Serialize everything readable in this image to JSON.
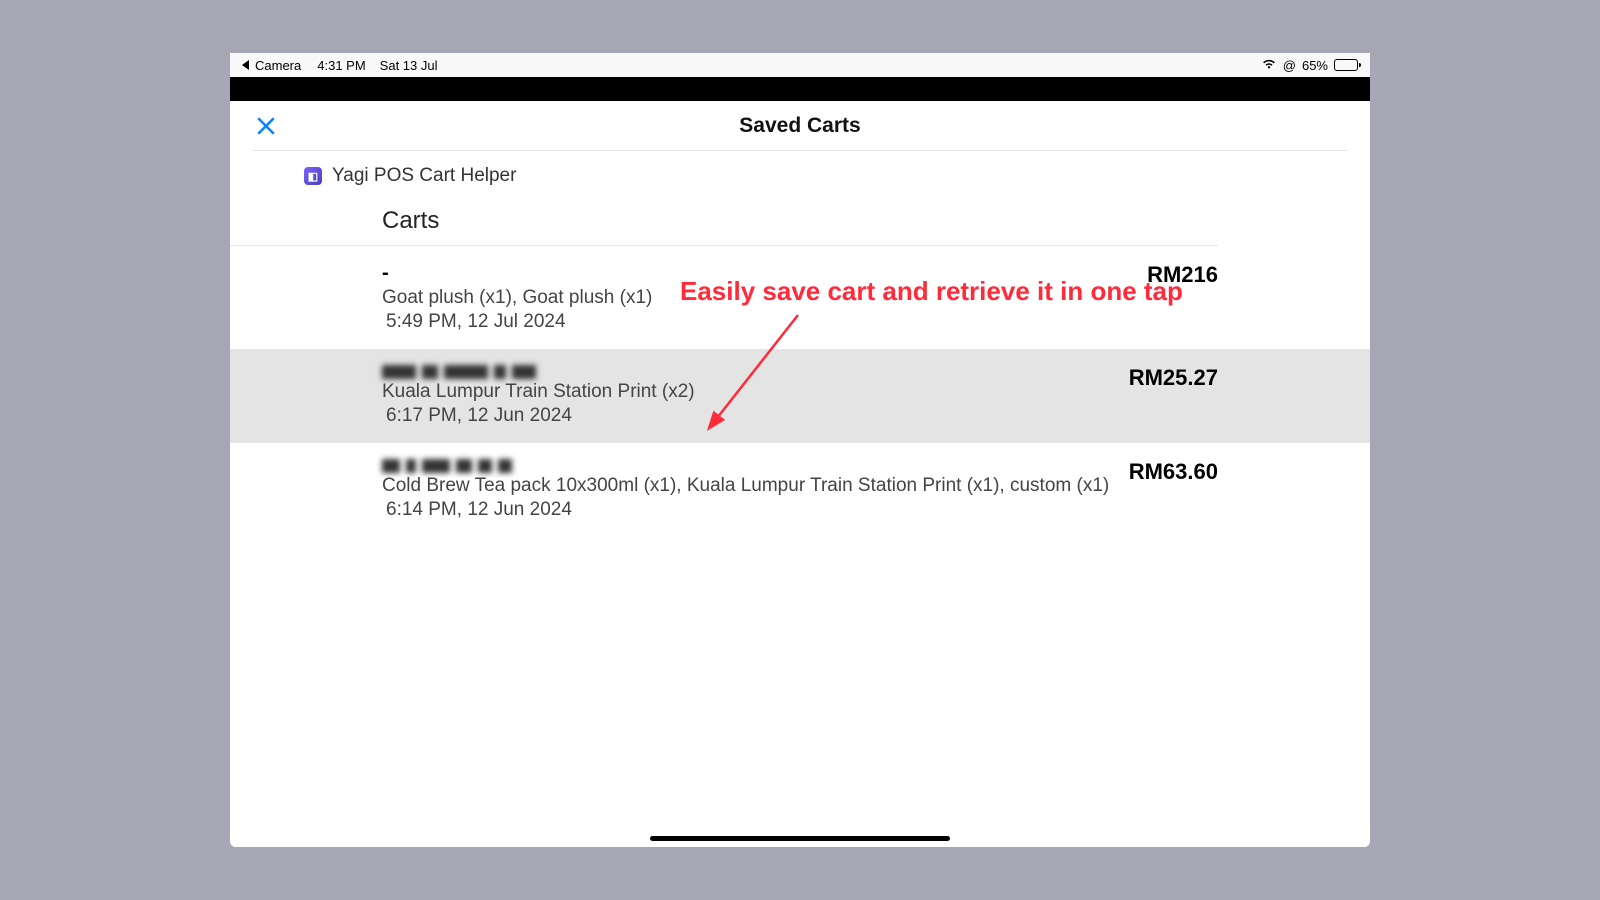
{
  "statusbar": {
    "back_app": "Camera",
    "time": "4:31 PM",
    "date": "Sat 13 Jul",
    "battery_pct": "65%"
  },
  "sheet": {
    "title": "Saved Carts",
    "app_name": "Yagi POS Cart Helper",
    "section_label": "Carts"
  },
  "carts": [
    {
      "name": "-",
      "items": "Goat plush (x1), Goat plush (x1)",
      "timestamp": "5:49 PM, 12 Jul 2024",
      "price": "RM216",
      "selected": false,
      "redacted": false
    },
    {
      "name": "",
      "items": "Kuala Lumpur Train Station Print (x2)",
      "timestamp": "6:17 PM, 12 Jun 2024",
      "price": "RM25.27",
      "selected": true,
      "redacted": true
    },
    {
      "name": "",
      "items": "Cold Brew Tea pack 10x300ml (x1), Kuala Lumpur Train Station Print (x1), custom (x1)",
      "timestamp": "6:14 PM, 12 Jun 2024",
      "price": "RM63.60",
      "selected": false,
      "redacted": true
    }
  ],
  "annotation": {
    "text": "Easily save cart and retrieve it in one tap"
  }
}
